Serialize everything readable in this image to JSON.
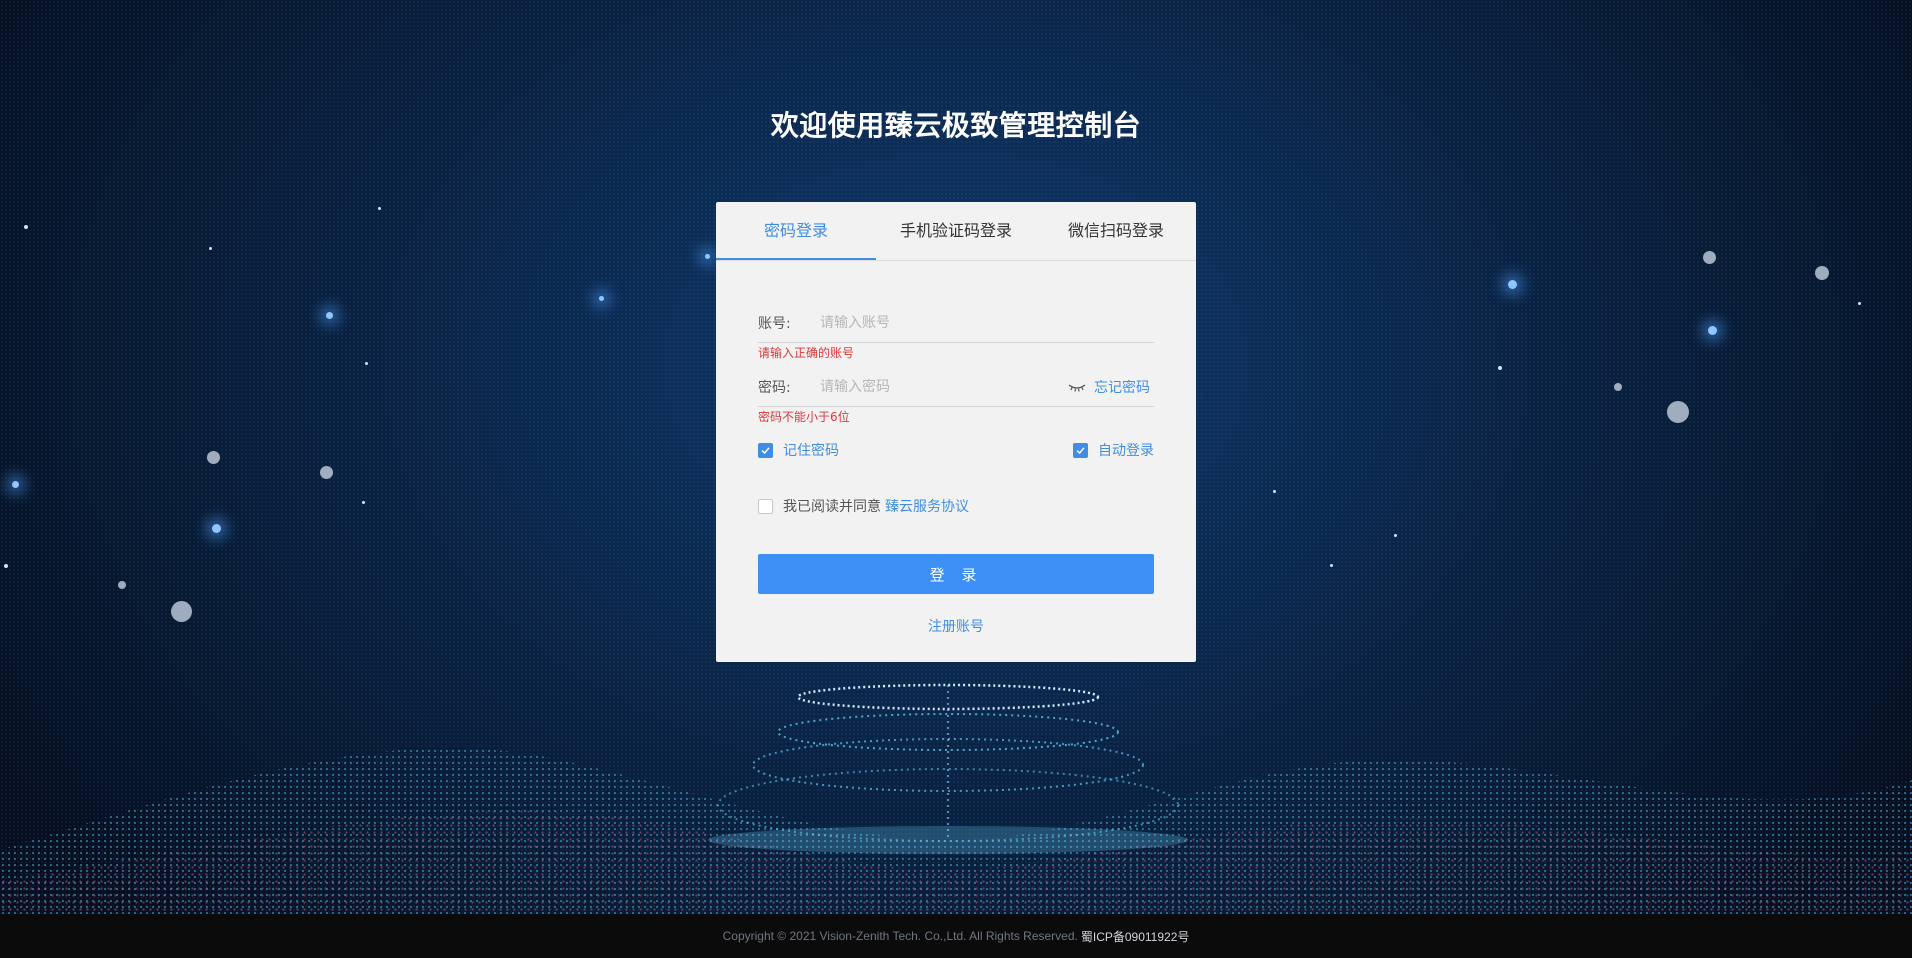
{
  "page": {
    "title": "欢迎使用臻云极致管理控制台"
  },
  "tabs": [
    {
      "label": "密码登录",
      "active": true
    },
    {
      "label": "手机验证码登录",
      "active": false
    },
    {
      "label": "微信扫码登录",
      "active": false
    }
  ],
  "form": {
    "account": {
      "label": "账号:",
      "placeholder": "请输入账号",
      "value": "",
      "error": "请输入正确的账号"
    },
    "password": {
      "label": "密码:",
      "placeholder": "请输入密码",
      "value": "",
      "error": "密码不能小于6位",
      "forgot_label": "忘记密码",
      "visibility_icon": "eye-closed-icon"
    },
    "remember": {
      "label": "记住密码",
      "checked": true
    },
    "auto_login": {
      "label": "自动登录",
      "checked": true
    },
    "agreement": {
      "text": "我已阅读并同意",
      "link": "臻云服务协议",
      "checked": false
    },
    "login_button": "登 录",
    "register_link": "注册账号"
  },
  "footer": {
    "copyright": "Copyright © 2021 Vision-Zenith Tech. Co.,Ltd. All Rights Reserved.",
    "icp": "蜀ICP备09011922号"
  },
  "colors": {
    "accent": "#3f8ee4",
    "button": "#3d90f5",
    "error": "#e0383b",
    "card": "#f2f2f2",
    "background": "#0a2548",
    "footer": "#0b0b0b"
  }
}
